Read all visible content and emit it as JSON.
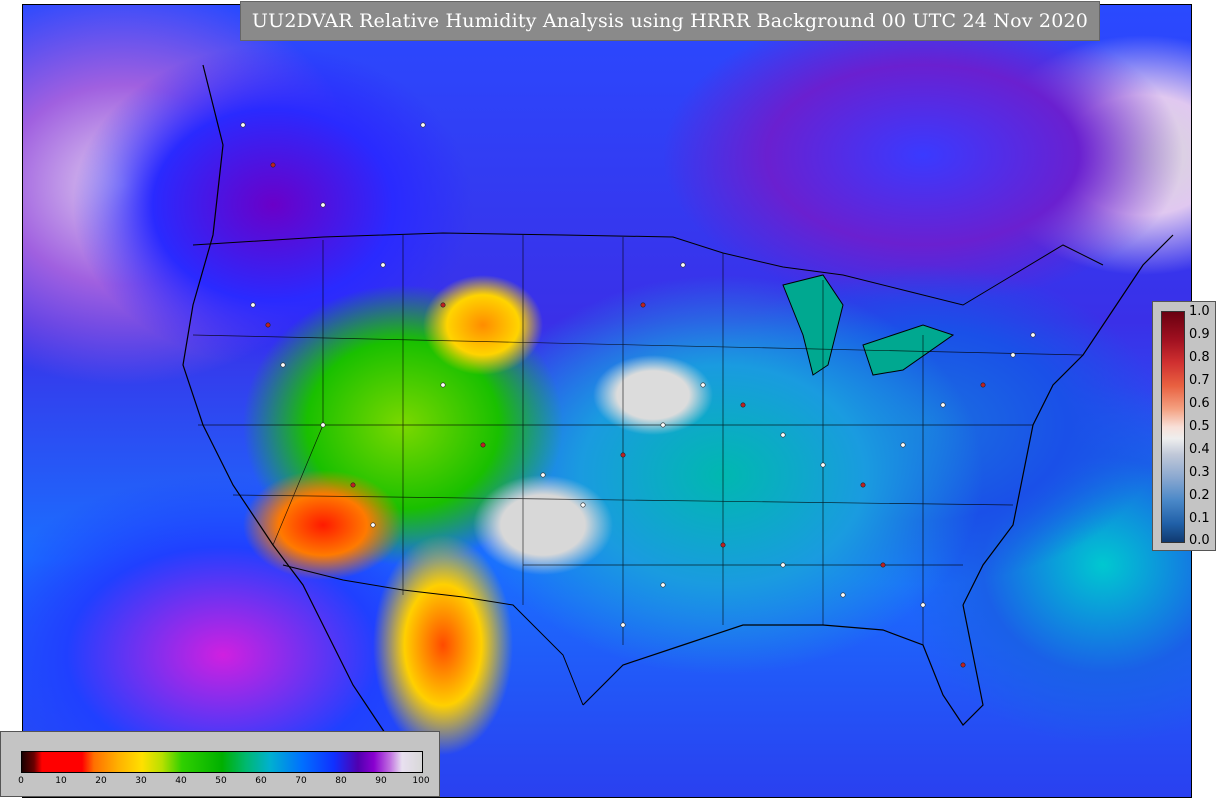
{
  "title": "UU2DVAR Relative Humidity Analysis using HRRR Background 00 UTC 24 Nov 2020",
  "observation_legend": {
    "ticks": [
      "1.0",
      "0.9",
      "0.8",
      "0.7",
      "0.6",
      "0.5",
      "0.4",
      "0.3",
      "0.2",
      "0.1",
      "0.0"
    ]
  },
  "rh_legend": {
    "ticks": [
      "0",
      "10",
      "20",
      "30",
      "40",
      "50",
      "60",
      "70",
      "80",
      "90",
      "100"
    ]
  },
  "icons": {
    "map": "humidity-map-icon"
  }
}
